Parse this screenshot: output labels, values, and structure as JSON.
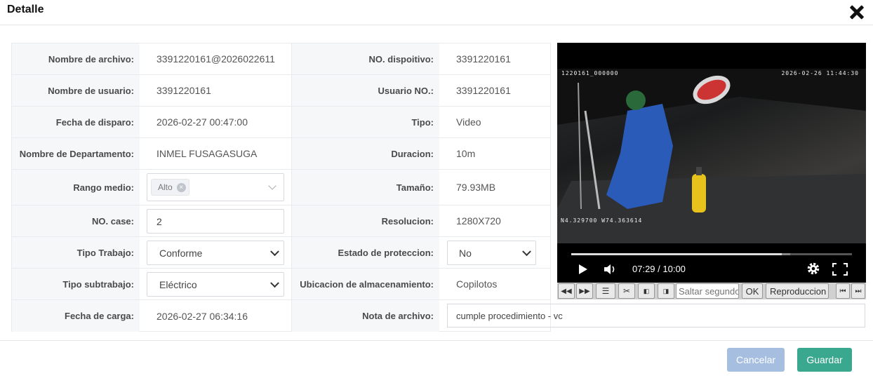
{
  "dialog": {
    "title": "Detalle"
  },
  "fields": {
    "nombre_archivo": {
      "label": "Nombre de archivo:",
      "value": "3391220161@2026022611"
    },
    "no_dispositivo": {
      "label": "NO. dispoitivo:",
      "value": "3391220161"
    },
    "nombre_usuario": {
      "label": "Nombre de usuario:",
      "value": "3391220161"
    },
    "usuario_no": {
      "label": "Usuario NO.:",
      "value": "3391220161"
    },
    "fecha_disparo": {
      "label": "Fecha de disparo:",
      "value": "2026-02-27 00:47:00"
    },
    "tipo": {
      "label": "Tipo:",
      "value": "Video"
    },
    "departamento": {
      "label": "Nombre de Departamento:",
      "value": "INMEL FUSAGASUGA"
    },
    "duracion": {
      "label": "Duracion:",
      "value": "10m"
    },
    "rango_medio": {
      "label": "Rango medio:",
      "tag": "Alto",
      "tag_remove": "×"
    },
    "tamano": {
      "label": "Tamaño:",
      "value": "79.93MB"
    },
    "no_case": {
      "label": "NO. case:",
      "value": "2"
    },
    "resolucion": {
      "label": "Resolucion:",
      "value": "1280X720"
    },
    "tipo_trabajo": {
      "label": "Tipo Trabajo:",
      "value": "Conforme"
    },
    "estado_proteccion": {
      "label": "Estado de proteccion:",
      "value": "No"
    },
    "tipo_subtrabajo": {
      "label": "Tipo subtrabajo:",
      "value": "Eléctrico"
    },
    "ubicacion": {
      "label": "Ubicacion de almacenamiento:",
      "value": "Copilotos"
    },
    "fecha_carga": {
      "label": "Fecha de carga:",
      "value": "2026-02-27 06:34:16"
    },
    "nota_archivo": {
      "label": "Nota de archivo:",
      "value": "cumple procedimiento - vc"
    }
  },
  "video": {
    "osd_top_left": "1220161_000000",
    "osd_top_right": "2026-02-26 11:44:30",
    "osd_bottom_left": "N4.329700 W74.363614",
    "time": "07:29 / 10:00",
    "progress": 0.749,
    "buffered": 0.78
  },
  "toolbar": {
    "jump_placeholder": "Saltar segundo",
    "ok_label": "OK",
    "playback_label": "Reproduccion"
  },
  "actions": {
    "cancel_label": "Cancelar",
    "save_label": "Guardar"
  },
  "colors": {
    "cancel": "#a6bfe0",
    "save": "#3aa88e"
  }
}
